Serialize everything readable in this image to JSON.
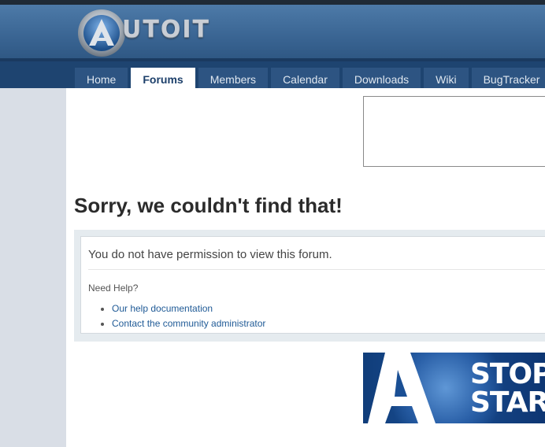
{
  "header": {
    "logo_text": "UTOIT"
  },
  "nav": {
    "tabs": [
      {
        "label": "Home"
      },
      {
        "label": "Forums"
      },
      {
        "label": "Members"
      },
      {
        "label": "Calendar"
      },
      {
        "label": "Downloads"
      },
      {
        "label": "Wiki"
      },
      {
        "label": "BugTracker"
      }
    ],
    "active": "Forums"
  },
  "main": {
    "title": "Sorry, we couldn't find that!",
    "message": "You do not have permission to view this forum.",
    "need_help": "Need Help?",
    "help_links": [
      {
        "label": "Our help documentation"
      },
      {
        "label": "Contact the community administrator"
      }
    ]
  },
  "banner": {
    "line1": "STOP",
    "line2": "STAR"
  },
  "colors": {
    "header": "#3a6593",
    "navbar": "#1e4470",
    "tab": "#2d5482",
    "link": "#1f5a96"
  }
}
